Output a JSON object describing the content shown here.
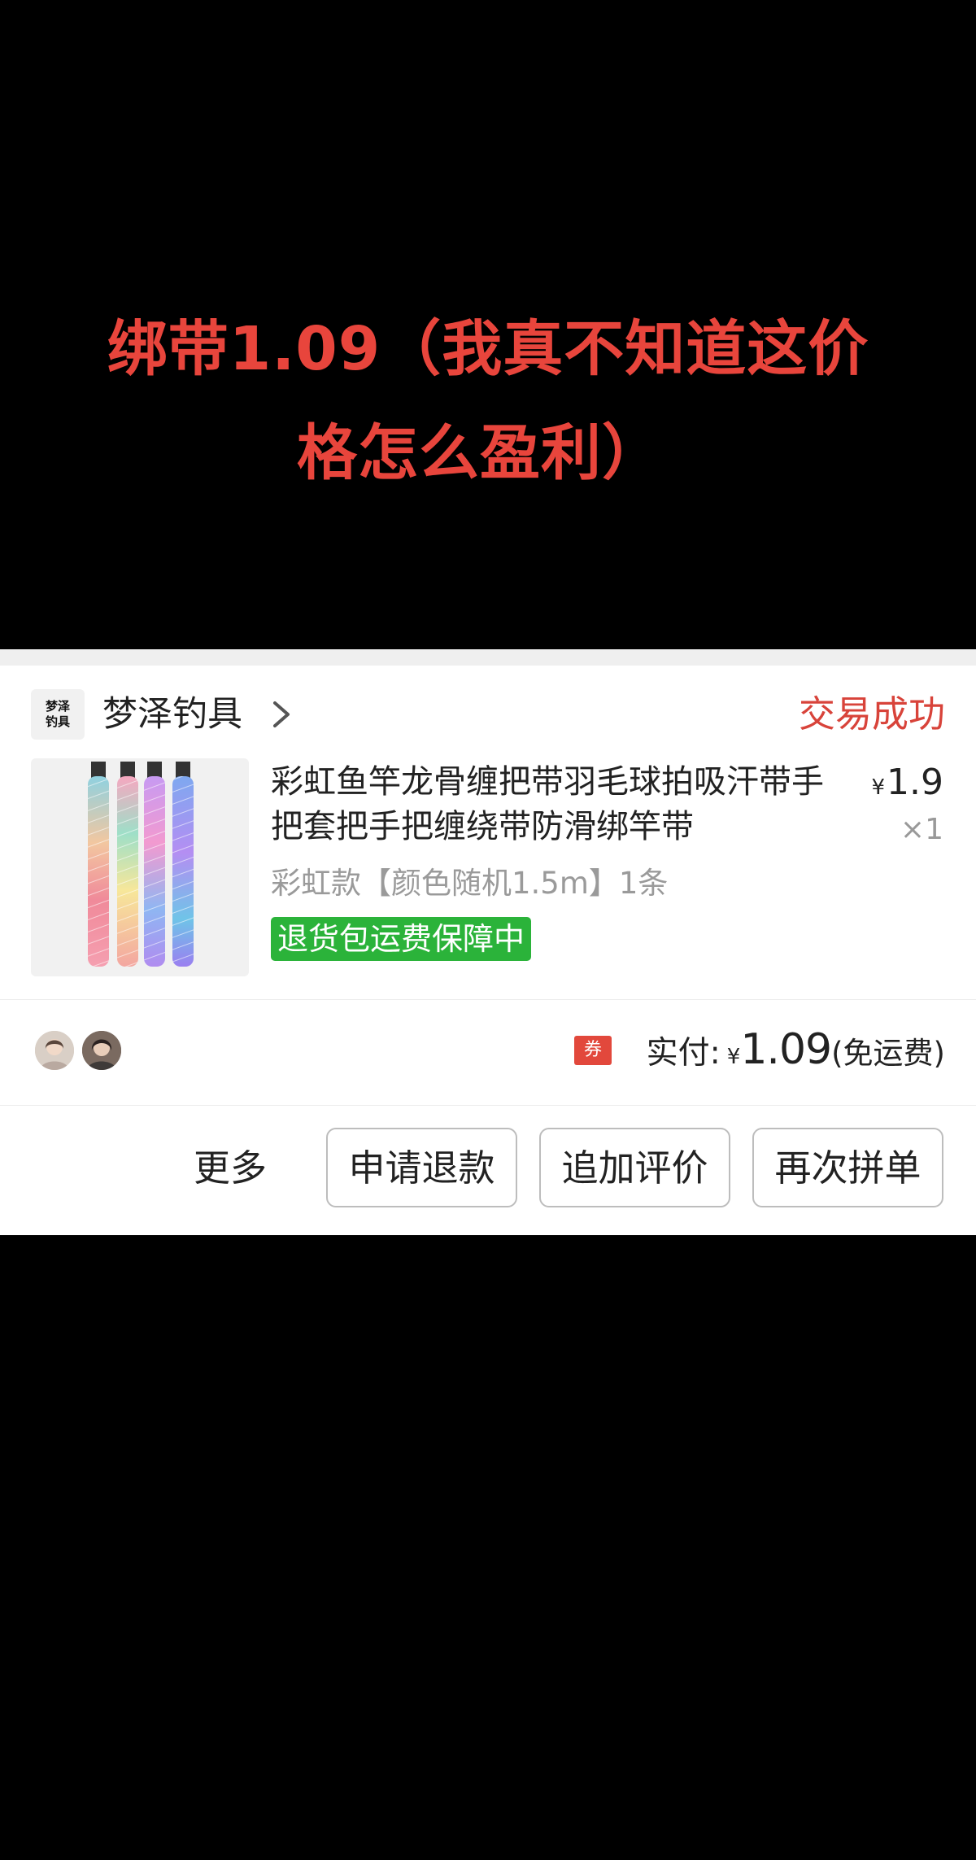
{
  "overlay": {
    "line1": "绑带1.09（我真不知道这价",
    "line2": "格怎么盈利）",
    "color": "#e8453c"
  },
  "order": {
    "shop": {
      "logo_text": "梦泽\n钓具",
      "name": "梦泽钓具"
    },
    "status": "交易成功",
    "status_color": "#d8433a",
    "product": {
      "title": "彩虹鱼竿龙骨缠把带羽毛球拍吸汗带手把套把手把缠绕带防滑绑竿带",
      "price_symbol": "¥",
      "price": "1.9",
      "quantity": "×1",
      "sku": "彩虹款【颜色随机1.5m】1条",
      "guarantee_badge": "退货包运费保障中",
      "guarantee_color": "#2bb33a"
    },
    "payment": {
      "coupon_icon": "券",
      "label": "实付:",
      "currency": "¥",
      "amount": "1.09",
      "note": "(免运费)"
    },
    "actions": {
      "more": "更多",
      "refund": "申请退款",
      "add_review": "追加评价",
      "reorder": "再次拼单"
    }
  }
}
